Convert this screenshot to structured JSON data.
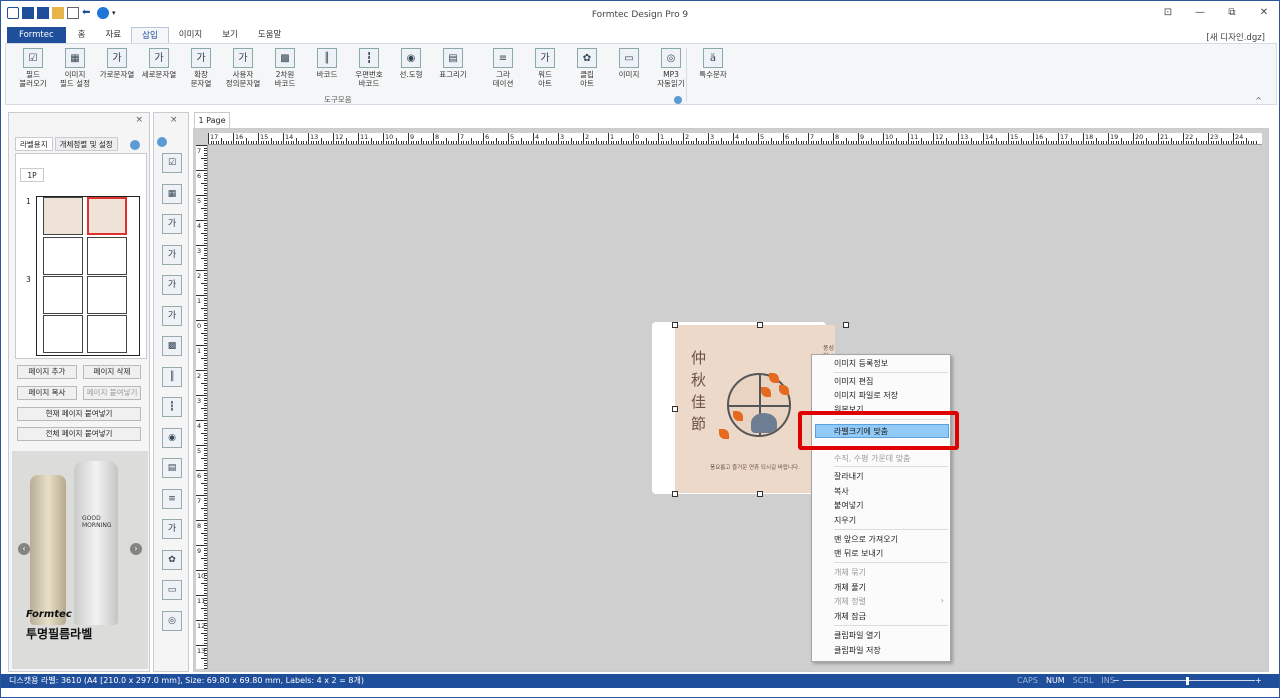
{
  "window": {
    "title": "Formtec Design Pro 9",
    "doc_name": "[새 디자인.dgz]",
    "controls": [
      "⊡",
      "—",
      "⧉",
      "✕"
    ]
  },
  "tabs": [
    {
      "label": "Formtec"
    },
    {
      "label": "홈"
    },
    {
      "label": "자료"
    },
    {
      "label": "삽입"
    },
    {
      "label": "이미지"
    },
    {
      "label": "보기"
    },
    {
      "label": "도움말"
    }
  ],
  "ribbon": {
    "items": [
      {
        "label": "필드\n불러오기",
        "icon": "☑"
      },
      {
        "label": "이미지\n필드 설정",
        "icon": "▦"
      },
      {
        "label": "가로문자열",
        "icon": "가"
      },
      {
        "label": "세로문자열",
        "icon": "가"
      },
      {
        "label": "확장\n문자열",
        "icon": "가"
      },
      {
        "label": "사용자\n정의문자열",
        "icon": "가"
      },
      {
        "label": "2차원\n바코드",
        "icon": "▩"
      },
      {
        "label": "바코드",
        "icon": "║"
      },
      {
        "label": "우편번호\n바코드",
        "icon": "┇"
      },
      {
        "label": "선.도형",
        "icon": "◉"
      },
      {
        "label": "표그리기",
        "icon": "▤"
      },
      {
        "label": "그라\n데이션",
        "icon": "≡"
      },
      {
        "label": "워드\n아트",
        "icon": "가"
      },
      {
        "label": "클립\n아트",
        "icon": "✿"
      },
      {
        "label": "이미지",
        "icon": "▭"
      },
      {
        "label": "MP3\n자동읽기",
        "icon": "◎"
      },
      {
        "label": "특수문자",
        "icon": "ä"
      }
    ],
    "group_label": "도구모음",
    "collapse": "^"
  },
  "leftpanel": {
    "close": "×",
    "tabs": [
      "라벨용지",
      "개체정렬 및 설정"
    ],
    "page_tab": "1P",
    "row_numbers": [
      "1",
      "3"
    ],
    "buttons": {
      "add_page": "페이지 추가",
      "delete_page": "페이지 삭제",
      "copy_page": "페이지 복사",
      "paste_page": "페이지 붙여넣기",
      "paste_current": "현재 페이지 붙여넣기",
      "paste_all": "전체 페이지 붙여넣기"
    },
    "ad": {
      "bottle_text": "GOOD\nMORNING",
      "brand": "Formtec",
      "headline": "투명필름라벨",
      "prev": "‹",
      "next": "›"
    }
  },
  "toolbox": {
    "close": "×",
    "icons": [
      "☑",
      "▦",
      "가",
      "가",
      "가",
      "가",
      "▩",
      "║",
      "┇",
      "◉",
      "▤",
      "≡",
      "가",
      "✿",
      "▭",
      "◎"
    ]
  },
  "canvas": {
    "page_tab": "1 Page",
    "ruler_top": [
      "17",
      "16",
      "15",
      "14",
      "13",
      "12",
      "11",
      "10",
      "9",
      "8",
      "7",
      "6",
      "5",
      "4",
      "3",
      "2",
      "1",
      "0",
      "1",
      "2",
      "3",
      "4",
      "5",
      "6",
      "7",
      "8",
      "9",
      "10",
      "11",
      "12",
      "13",
      "14",
      "15",
      "16",
      "17",
      "18",
      "19",
      "20",
      "21",
      "22",
      "23",
      "24"
    ],
    "ruler_left": [
      "7",
      "6",
      "5",
      "4",
      "3",
      "2",
      "1",
      "0",
      "1",
      "2",
      "3",
      "4",
      "5",
      "6",
      "7",
      "8",
      "9",
      "10",
      "11",
      "12",
      "13"
    ]
  },
  "label": {
    "kanji": "仲秋佳節",
    "greeting": "풍요롭고 즐거운 연휴 되시길 바랍니다.",
    "side_text": "풍성한 한가위 되세요"
  },
  "context_menu": {
    "items": [
      {
        "label": "이미지 등록정보",
        "disabled": false
      },
      {
        "label": "이미지 편집",
        "disabled": false
      },
      {
        "label": "이미지 파일로 저장",
        "disabled": false
      },
      {
        "label": "원본보기",
        "disabled": false
      },
      {
        "label": "라벨크기에 맞춤",
        "disabled": false,
        "highlight": true
      },
      {
        "label": "수직, 수평 가운데 맞춤",
        "disabled": true
      },
      {
        "label": "잘라내기",
        "disabled": false
      },
      {
        "label": "복사",
        "disabled": false
      },
      {
        "label": "붙여넣기",
        "disabled": false
      },
      {
        "label": "지우기",
        "disabled": false
      },
      {
        "label": "맨 앞으로 가져오기",
        "disabled": false
      },
      {
        "label": "맨 뒤로 보내기",
        "disabled": false
      },
      {
        "label": "개체 묶기",
        "disabled": true
      },
      {
        "label": "개체 풀기",
        "disabled": false
      },
      {
        "label": "개체 정렬",
        "disabled": true,
        "submenu": "›"
      },
      {
        "label": "개체 잠금",
        "disabled": false
      },
      {
        "label": "클립파일 열기",
        "disabled": false
      },
      {
        "label": "클립파일 저장",
        "disabled": false
      }
    ]
  },
  "statusbar": {
    "text": "디스캣용 라벨: 3610 (A4 [210.0 x 297.0 mm], Size: 69.80 x 69.80 mm,  Labels: 4 x 2 = 8개)",
    "keys": [
      {
        "label": "CAPS",
        "on": false
      },
      {
        "label": "NUM",
        "on": true
      },
      {
        "label": "SCRL",
        "on": false
      },
      {
        "label": "INS",
        "on": false
      }
    ],
    "zoom_minus": "−",
    "zoom_plus": "+"
  },
  "colors": {
    "accent": "#1f4e9a",
    "highlight": "#91c9f7",
    "annotation": "#e00000"
  }
}
